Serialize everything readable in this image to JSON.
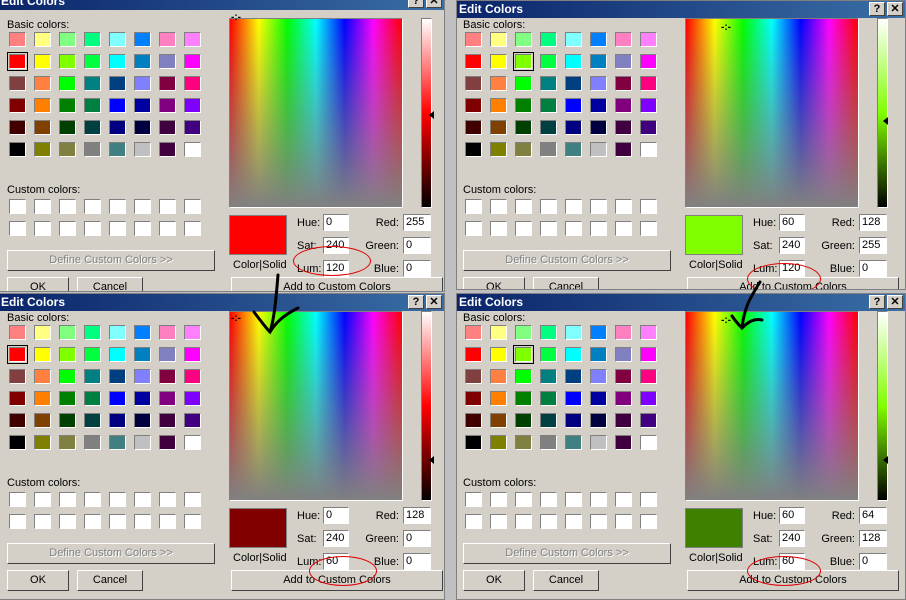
{
  "dialog": {
    "title": "Edit Colors",
    "help_glyph": "?",
    "close_glyph": "✕",
    "basic_label": "Basic colors:",
    "custom_label": "Custom colors:",
    "define_label": "Define Custom Colors >>",
    "colorsolid_label": "Color|Solid",
    "hue_label": "Hue:",
    "sat_label": "Sat:",
    "lum_label": "Lum:",
    "red_label": "Red:",
    "green_label": "Green:",
    "blue_label": "Blue:",
    "ok_label": "OK",
    "cancel_label": "Cancel",
    "add_label": "Add to Custom Colors"
  },
  "basic_colors": [
    [
      "#ff8080",
      "#ffff80",
      "#80ff80",
      "#00ff80",
      "#80ffff",
      "#0080ff",
      "#ff80c0",
      "#ff80ff"
    ],
    [
      "#ff0000",
      "#ffff00",
      "#80ff00",
      "#00ff40",
      "#00ffff",
      "#0080c0",
      "#8080c0",
      "#ff00ff"
    ],
    [
      "#804040",
      "#ff8040",
      "#00ff00",
      "#008080",
      "#004080",
      "#8080ff",
      "#800040",
      "#ff0080"
    ],
    [
      "#800000",
      "#ff8000",
      "#008000",
      "#008040",
      "#0000ff",
      "#0000a0",
      "#800080",
      "#8000ff"
    ],
    [
      "#400000",
      "#804000",
      "#004000",
      "#004040",
      "#000080",
      "#000040",
      "#400040",
      "#400080"
    ],
    [
      "#000000",
      "#808000",
      "#808040",
      "#808080",
      "#408080",
      "#c0c0c0",
      "#400040",
      "#ffffff"
    ]
  ],
  "panels": [
    {
      "hue": "0",
      "sat": "240",
      "lum": "120",
      "red": "255",
      "green": "0",
      "blue": "0",
      "preview": "#ff0000",
      "lum_top": "#ffffff",
      "lum_mid": "#ff0000",
      "lum_bottom": "#000000"
    },
    {
      "hue": "60",
      "sat": "240",
      "lum": "120",
      "red": "128",
      "green": "255",
      "blue": "0",
      "preview": "#80ff00",
      "lum_top": "#ffffff",
      "lum_mid": "#80ff00",
      "lum_bottom": "#000000"
    },
    {
      "hue": "0",
      "sat": "240",
      "lum": "60",
      "red": "128",
      "green": "0",
      "blue": "0",
      "preview": "#800000",
      "lum_top": "#ffffff",
      "lum_mid": "#ff0000",
      "lum_bottom": "#000000"
    },
    {
      "hue": "60",
      "sat": "240",
      "lum": "60",
      "red": "64",
      "green": "128",
      "blue": "0",
      "preview": "#408000",
      "lum_top": "#ffffff",
      "lum_mid": "#80ff00",
      "lum_bottom": "#000000"
    }
  ],
  "accent": {
    "annotation_red": "#e00000",
    "title_blue": "#0a246a"
  }
}
